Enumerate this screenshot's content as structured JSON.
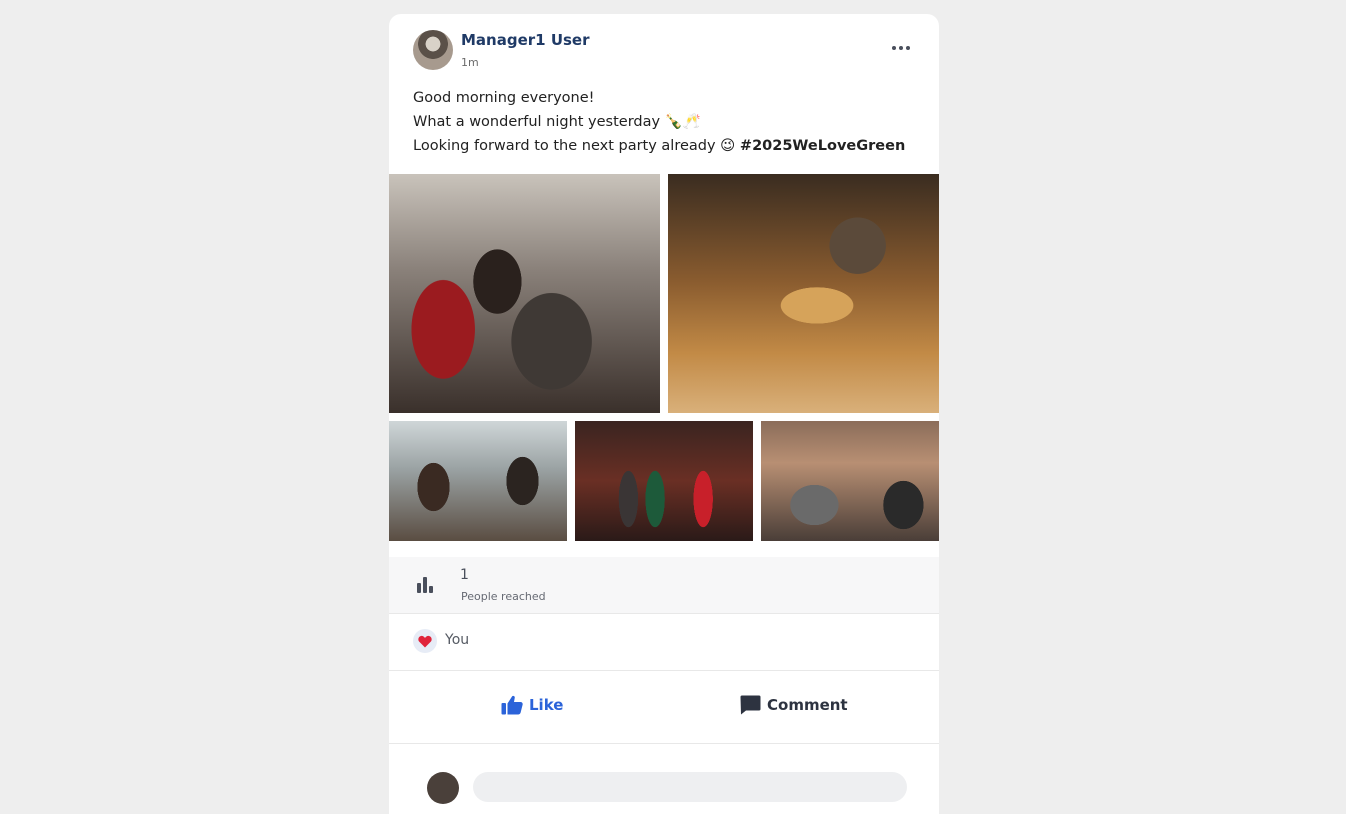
{
  "post": {
    "author": "Manager1 User",
    "time": "1m",
    "lines": [
      "Good morning everyone!",
      "What a wonderful night yesterday 🍾🥂",
      "Looking forward to the next party already 😉 "
    ],
    "hashtag": "#2025WeLoveGreen"
  },
  "stats": {
    "count": "1",
    "label": "People reached"
  },
  "reactions": {
    "user": "You",
    "icon": "heart-icon",
    "color": "#e0243b"
  },
  "actions": {
    "like": "Like",
    "comment": "Comment",
    "like_color": "#2b63d9"
  }
}
